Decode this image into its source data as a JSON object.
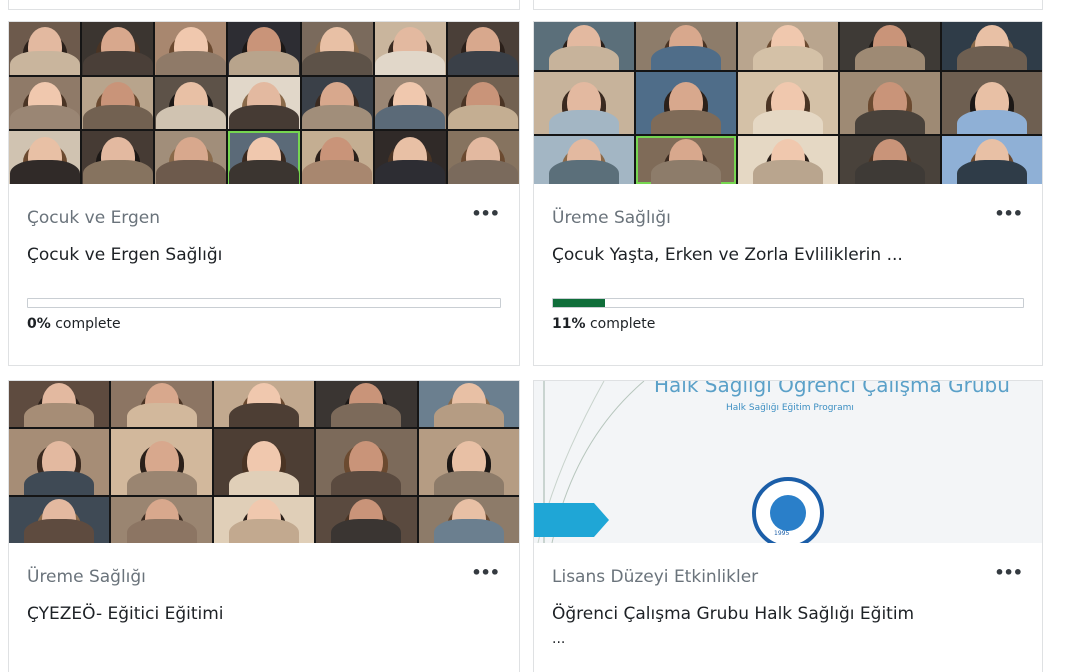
{
  "courses": [
    {
      "category": "Çocuk ve Ergen",
      "name": "Çocuk ve Ergen Sağlığı",
      "progress_pct": 0,
      "progress_value": "0%",
      "progress_suffix": " complete",
      "more_label": "•••"
    },
    {
      "category": "Üreme Sağlığı",
      "name": "Çocuk Yaşta, Erken ve Zorla Evliliklerin ...",
      "progress_pct": 11,
      "progress_value": "11%",
      "progress_suffix": " complete",
      "more_label": "•••"
    },
    {
      "category": "Üreme Sağlığı",
      "name": "ÇYEZEÖ- Eğitici Eğitimi",
      "more_label": "•••"
    },
    {
      "category": "Lisans Düzeyi Etkinlikler",
      "name": "Öğrenci Çalışma Grubu Halk Sağlığı Eğitim",
      "name_overflow": "...",
      "more_label": "•••",
      "slide": {
        "title": "Halk Sağlığı Öğrenci Çalışma Grubu",
        "subtitle": "Halk Sağlığı Eğitim Programı",
        "logo_text": "1995"
      }
    }
  ],
  "colors": {
    "progress_fill": "#0f6e3a",
    "card_border": "#dfe1e3",
    "category_text": "#6a737b"
  },
  "icons": {
    "more": "more-options-icon"
  }
}
